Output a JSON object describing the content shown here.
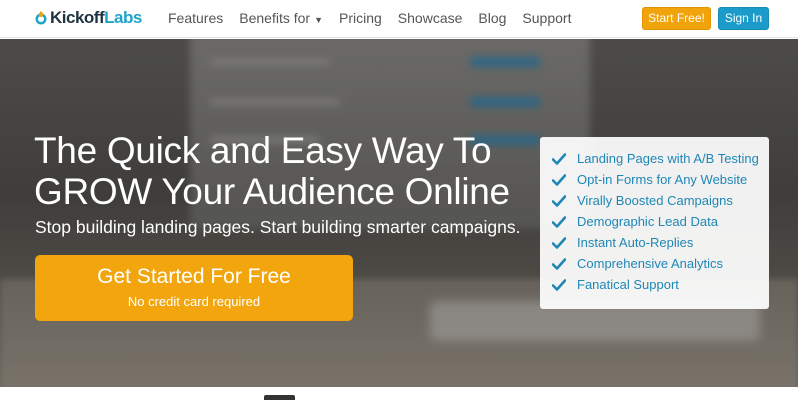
{
  "brand": {
    "name_part1": "Kickoff",
    "name_part2": "Labs"
  },
  "nav": {
    "links": [
      {
        "label": "Features"
      },
      {
        "label": "Benefits for",
        "has_caret": true
      },
      {
        "label": "Pricing"
      },
      {
        "label": "Showcase"
      },
      {
        "label": "Blog"
      },
      {
        "label": "Support"
      }
    ],
    "start_free_label": "Start Free!",
    "sign_in_label": "Sign In"
  },
  "hero": {
    "headline_line1": "The Quick and Easy Way To",
    "headline_line2": "GROW Your Audience Online",
    "subhead": "Stop building landing pages. Start building smarter campaigns.",
    "cta_main": "Get Started For Free",
    "cta_sub": "No credit card required"
  },
  "features": [
    {
      "label": "Landing Pages with A/B Testing"
    },
    {
      "label": "Opt-in Forms for Any Website"
    },
    {
      "label": "Virally Boosted Campaigns"
    },
    {
      "label": "Demographic Lead Data"
    },
    {
      "label": "Instant Auto-Replies"
    },
    {
      "label": "Comprehensive Analytics"
    },
    {
      "label": "Fanatical Support"
    }
  ],
  "icons": {
    "logo": "rocket-flame-icon",
    "check": "check-icon",
    "caret": "caret-down-icon"
  },
  "colors": {
    "accent_orange": "#f0a30a",
    "accent_blue": "#1a9bc9",
    "feature_text": "#1f87b6",
    "logo_dark": "#1f3340"
  }
}
